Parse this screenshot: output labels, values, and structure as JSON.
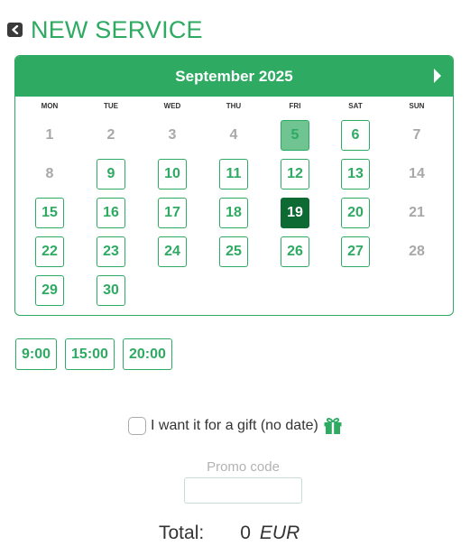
{
  "header": {
    "title": "NEW SERVICE",
    "back_icon": "chevron-left-icon"
  },
  "calendar": {
    "month_label": "September 2025",
    "next_icon": "triangle-right-icon",
    "weekdays": [
      "MON",
      "TUE",
      "WED",
      "THU",
      "FRI",
      "SAT",
      "SUN"
    ],
    "weeks": [
      [
        {
          "day": "1",
          "state": "disabled"
        },
        {
          "day": "2",
          "state": "disabled"
        },
        {
          "day": "3",
          "state": "disabled"
        },
        {
          "day": "4",
          "state": "disabled"
        },
        {
          "day": "5",
          "state": "today"
        },
        {
          "day": "6",
          "state": "available"
        },
        {
          "day": "7",
          "state": "disabled"
        }
      ],
      [
        {
          "day": "8",
          "state": "disabled"
        },
        {
          "day": "9",
          "state": "available"
        },
        {
          "day": "10",
          "state": "available"
        },
        {
          "day": "11",
          "state": "available"
        },
        {
          "day": "12",
          "state": "available"
        },
        {
          "day": "13",
          "state": "available"
        },
        {
          "day": "14",
          "state": "disabled"
        }
      ],
      [
        {
          "day": "15",
          "state": "available"
        },
        {
          "day": "16",
          "state": "available"
        },
        {
          "day": "17",
          "state": "available"
        },
        {
          "day": "18",
          "state": "available"
        },
        {
          "day": "19",
          "state": "selected"
        },
        {
          "day": "20",
          "state": "available"
        },
        {
          "day": "21",
          "state": "disabled"
        }
      ],
      [
        {
          "day": "22",
          "state": "available"
        },
        {
          "day": "23",
          "state": "available"
        },
        {
          "day": "24",
          "state": "available"
        },
        {
          "day": "25",
          "state": "available"
        },
        {
          "day": "26",
          "state": "available"
        },
        {
          "day": "27",
          "state": "available"
        },
        {
          "day": "28",
          "state": "disabled"
        }
      ],
      [
        {
          "day": "29",
          "state": "available"
        },
        {
          "day": "30",
          "state": "available"
        }
      ]
    ]
  },
  "times": [
    "9:00",
    "15:00",
    "20:00"
  ],
  "gift": {
    "label": "I want it for a gift  (no date)",
    "checked": false,
    "icon": "gift-icon"
  },
  "promo": {
    "label": "Promo code",
    "value": "",
    "placeholder": ""
  },
  "total": {
    "label": "Total:",
    "amount": "0",
    "currency": "EUR"
  },
  "colors": {
    "accent": "#2eaa62",
    "selected": "#0d6a33",
    "today": "#6fc491",
    "disabled_text": "#a8a8a8"
  }
}
